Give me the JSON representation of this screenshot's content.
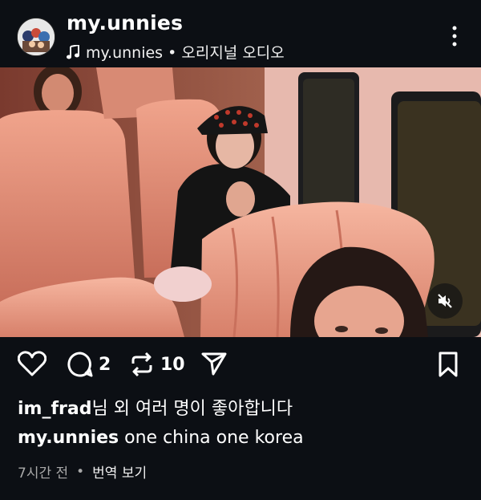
{
  "post": {
    "username": "my.unnies",
    "audio": "my.unnies • 오리지널 오디오",
    "likes_user": "im_frad",
    "likes_suffix": "님 외 여러 명이 좋아합니다",
    "caption_user": "my.unnies",
    "caption_text": "one china one korea",
    "time": "7시간 전",
    "separator": "•",
    "translate": "번역 보기"
  },
  "actions": {
    "comments": "2",
    "reposts": "10"
  },
  "icons": {
    "more": "more-vertical-icon",
    "music": "music-note-icon",
    "like": "heart-icon",
    "comment": "comment-icon",
    "repost": "repost-icon",
    "share": "send-icon",
    "save": "bookmark-icon",
    "mute": "speaker-muted-icon"
  },
  "colors": {
    "background": "#0c0f14",
    "text": "#ffffff",
    "muted": "#a9a9a9"
  }
}
